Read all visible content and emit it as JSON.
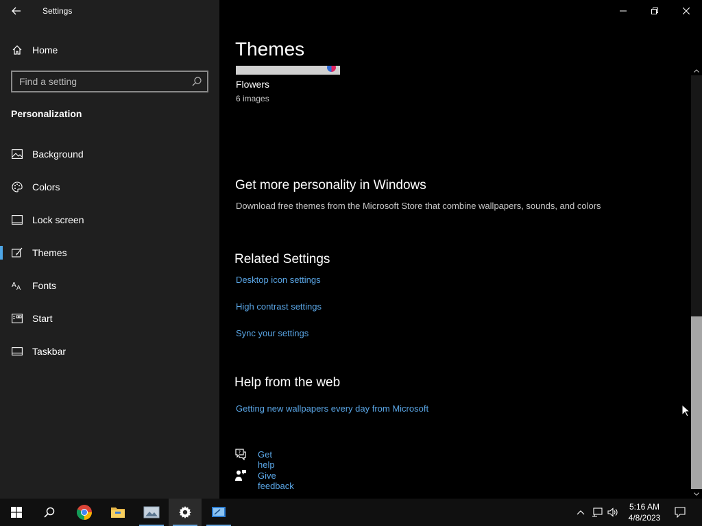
{
  "window": {
    "title": "Settings"
  },
  "sidebar": {
    "home_label": "Home",
    "search_placeholder": "Find a setting",
    "section_title": "Personalization",
    "items": [
      {
        "label": "Background",
        "icon": "image-icon"
      },
      {
        "label": "Colors",
        "icon": "palette-icon"
      },
      {
        "label": "Lock screen",
        "icon": "lock-screen-icon"
      },
      {
        "label": "Themes",
        "icon": "brush-icon",
        "selected": true
      },
      {
        "label": "Fonts",
        "icon": "font-icon"
      },
      {
        "label": "Start",
        "icon": "start-menu-icon"
      },
      {
        "label": "Taskbar",
        "icon": "taskbar-icon"
      }
    ]
  },
  "main": {
    "title": "Themes",
    "theme": {
      "name": "Flowers",
      "count": "6 images"
    },
    "more": {
      "title": "Get more personality in Windows",
      "description": "Download free themes from the Microsoft Store that combine wallpapers, sounds, and colors"
    },
    "related": {
      "title": "Related Settings",
      "links": [
        "Desktop icon settings",
        "High contrast settings",
        "Sync your settings"
      ]
    },
    "help": {
      "title": "Help from the web",
      "link": "Getting new wallpapers every day from Microsoft",
      "get_help": "Get help",
      "give_feedback": "Give feedback"
    }
  },
  "taskbar": {
    "time": "5:16 AM",
    "date": "4/8/2023",
    "apps": [
      "windows-start-icon",
      "search-icon",
      "chrome-icon",
      "file-explorer-icon",
      "picture-viewer-icon",
      "settings-icon",
      "remote-desktop-icon"
    ]
  },
  "colors": {
    "accent": "#5aa6e6",
    "sidebar_bg": "#1f1f1f",
    "main_bg": "#000000"
  }
}
